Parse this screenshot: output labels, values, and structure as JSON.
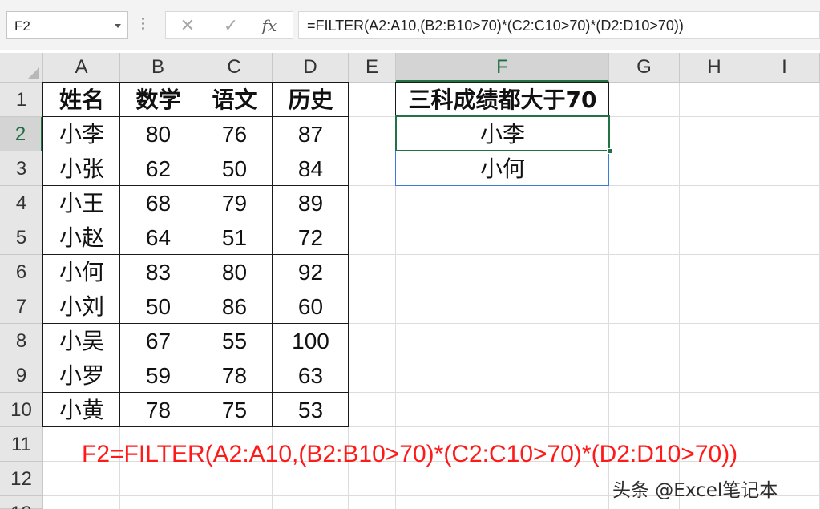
{
  "formula_bar": {
    "name_box": "F2",
    "cancel_glyph": "✕",
    "enter_glyph": "✓",
    "fx_label": "fx",
    "formula": "=FILTER(A2:A10,(B2:B10>70)*(C2:C10>70)*(D2:D10>70))"
  },
  "grid": {
    "columns": [
      "A",
      "B",
      "C",
      "D",
      "E",
      "F",
      "G",
      "H",
      "I"
    ],
    "rows": [
      "1",
      "2",
      "3",
      "4",
      "5",
      "6",
      "7",
      "8",
      "9",
      "10",
      "11",
      "12",
      "13"
    ],
    "selected_column": "F",
    "selected_row": "2"
  },
  "table": {
    "headers": [
      "姓名",
      "数学",
      "语文",
      "历史"
    ],
    "rows": [
      [
        "小李",
        "80",
        "76",
        "87"
      ],
      [
        "小张",
        "62",
        "50",
        "84"
      ],
      [
        "小王",
        "68",
        "79",
        "89"
      ],
      [
        "小赵",
        "64",
        "51",
        "72"
      ],
      [
        "小何",
        "83",
        "80",
        "92"
      ],
      [
        "小刘",
        "50",
        "86",
        "60"
      ],
      [
        "小吴",
        "67",
        "55",
        "100"
      ],
      [
        "小罗",
        "59",
        "78",
        "63"
      ],
      [
        "小黄",
        "78",
        "75",
        "53"
      ]
    ]
  },
  "result": {
    "header": "三科成绩都大于70",
    "values": [
      "小李",
      "小何"
    ]
  },
  "annotation": "F2=FILTER(A2:A10,(B2:B10>70)*(C2:C10>70)*(D2:D10>70))",
  "watermark": "头条 @Excel笔记本",
  "colors": {
    "accent_green": "#217346",
    "annotation_red": "#ff1a1a"
  }
}
